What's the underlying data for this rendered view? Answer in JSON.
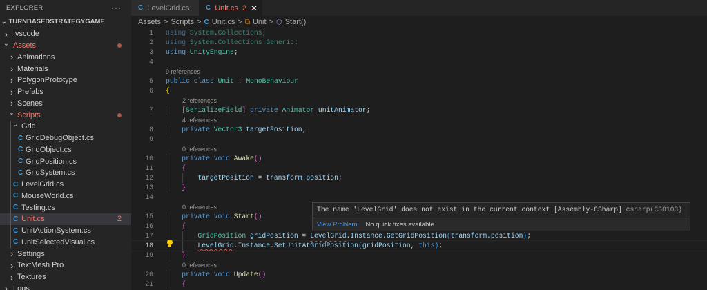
{
  "sidebar": {
    "title": "EXPLORER",
    "more": "···",
    "project": "TURNBASEDSTRATEGYGAME",
    "items": [
      {
        "label": ".vscode",
        "level": 0,
        "kind": "folder",
        "open": false
      },
      {
        "label": "Assets",
        "level": 0,
        "kind": "folder",
        "open": true,
        "error": true,
        "dot": true
      },
      {
        "label": "Animations",
        "level": 1,
        "kind": "folder",
        "open": false
      },
      {
        "label": "Materials",
        "level": 1,
        "kind": "folder",
        "open": false
      },
      {
        "label": "PolygonPrototype",
        "level": 1,
        "kind": "folder",
        "open": false
      },
      {
        "label": "Prefabs",
        "level": 1,
        "kind": "folder",
        "open": false
      },
      {
        "label": "Scenes",
        "level": 1,
        "kind": "folder",
        "open": false
      },
      {
        "label": "Scripts",
        "level": 1,
        "kind": "folder",
        "open": true,
        "error": true,
        "dot": true
      },
      {
        "label": "Grid",
        "level": 2,
        "kind": "folder",
        "open": true
      },
      {
        "label": "GridDebugObject.cs",
        "level": 3,
        "kind": "file"
      },
      {
        "label": "GridObject.cs",
        "level": 3,
        "kind": "file"
      },
      {
        "label": "GridPosition.cs",
        "level": 3,
        "kind": "file"
      },
      {
        "label": "GridSystem.cs",
        "level": 3,
        "kind": "file"
      },
      {
        "label": "LevelGrid.cs",
        "level": 2,
        "kind": "file"
      },
      {
        "label": "MouseWorld.cs",
        "level": 2,
        "kind": "file"
      },
      {
        "label": "Testing.cs",
        "level": 2,
        "kind": "file"
      },
      {
        "label": "Unit.cs",
        "level": 2,
        "kind": "file",
        "error": true,
        "selected": true,
        "badge": "2"
      },
      {
        "label": "UnitActionSystem.cs",
        "level": 2,
        "kind": "file"
      },
      {
        "label": "UnitSelectedVisual.cs",
        "level": 2,
        "kind": "file"
      },
      {
        "label": "Settings",
        "level": 1,
        "kind": "folder",
        "open": false
      },
      {
        "label": "TextMesh Pro",
        "level": 1,
        "kind": "folder",
        "open": false
      },
      {
        "label": "Textures",
        "level": 1,
        "kind": "folder",
        "open": false
      },
      {
        "label": "Logs",
        "level": 0,
        "kind": "folder",
        "open": false
      }
    ]
  },
  "tabs": [
    {
      "label": "LevelGrid.cs",
      "active": false
    },
    {
      "label": "Unit.cs",
      "active": true,
      "problems": "2",
      "close": "✕"
    }
  ],
  "breadcrumb": {
    "items": [
      "Assets",
      "Scripts",
      "Unit.cs",
      "Unit",
      "Start()"
    ],
    "sep": ">"
  },
  "editor": {
    "lines": [
      {
        "n": "1",
        "tk": [
          [
            "using ",
            "kw dim"
          ],
          [
            "System",
            "ty dim"
          ],
          [
            ".",
            "pl dim"
          ],
          [
            "Collections",
            "ty dim"
          ],
          [
            ";",
            "pl dim"
          ]
        ]
      },
      {
        "n": "2",
        "tk": [
          [
            "using ",
            "kw dim"
          ],
          [
            "System",
            "ty dim"
          ],
          [
            ".",
            "pl dim"
          ],
          [
            "Collections",
            "ty dim"
          ],
          [
            ".",
            "pl dim"
          ],
          [
            "Generic",
            "ty dim"
          ],
          [
            ";",
            "pl dim"
          ]
        ]
      },
      {
        "n": "3",
        "tk": [
          [
            "using ",
            "kw"
          ],
          [
            "UnityEngine",
            "ty"
          ],
          [
            ";",
            "pl"
          ]
        ]
      },
      {
        "n": "4",
        "tk": []
      },
      {
        "refs": "9 references",
        "indent": 0
      },
      {
        "n": "5",
        "tk": [
          [
            "public ",
            "kw"
          ],
          [
            "class ",
            "kw"
          ],
          [
            "Unit",
            "ty"
          ],
          [
            " : ",
            "pl"
          ],
          [
            "MonoBehaviour",
            "ty"
          ]
        ]
      },
      {
        "n": "6",
        "tk": [
          [
            "{",
            "br1"
          ]
        ]
      },
      {
        "refs": "2 references",
        "indent": 1
      },
      {
        "n": "7",
        "indent": 1,
        "tk": [
          [
            "[",
            "br2"
          ],
          [
            "SerializeField",
            "ty"
          ],
          [
            "]",
            "br2"
          ],
          [
            " private ",
            "kw"
          ],
          [
            "Animator ",
            "ty"
          ],
          [
            "unitAnimator",
            "id"
          ],
          [
            ";",
            "pl"
          ]
        ]
      },
      {
        "refs": "4 references",
        "indent": 1
      },
      {
        "n": "8",
        "indent": 1,
        "tk": [
          [
            "private ",
            "kw"
          ],
          [
            "Vector3 ",
            "ty"
          ],
          [
            "targetPosition",
            "id"
          ],
          [
            ";",
            "pl"
          ]
        ]
      },
      {
        "n": "9",
        "tk": []
      },
      {
        "refs": "0 references",
        "indent": 1
      },
      {
        "n": "10",
        "indent": 1,
        "tk": [
          [
            "private ",
            "kw"
          ],
          [
            "void ",
            "kw"
          ],
          [
            "Awake",
            "fn"
          ],
          [
            "()",
            "br2"
          ]
        ]
      },
      {
        "n": "11",
        "indent": 1,
        "tk": [
          [
            "{",
            "br2"
          ]
        ]
      },
      {
        "n": "12",
        "indent": 2,
        "tk": [
          [
            "targetPosition",
            "id"
          ],
          [
            " = ",
            "pl"
          ],
          [
            "transform",
            "id"
          ],
          [
            ".",
            "pl"
          ],
          [
            "position",
            "id"
          ],
          [
            ";",
            "pl"
          ]
        ]
      },
      {
        "n": "13",
        "indent": 1,
        "tk": [
          [
            "}",
            "br2"
          ]
        ]
      },
      {
        "n": "14",
        "tk": []
      },
      {
        "refs": "0 references",
        "indent": 1
      },
      {
        "n": "15",
        "indent": 1,
        "tk": [
          [
            "private ",
            "kw"
          ],
          [
            "void ",
            "kw"
          ],
          [
            "Start",
            "fn"
          ],
          [
            "()",
            "br2"
          ]
        ]
      },
      {
        "n": "16",
        "indent": 1,
        "tk": [
          [
            "{",
            "br2"
          ]
        ]
      },
      {
        "n": "17",
        "indent": 2,
        "tk": [
          [
            "GridPosition ",
            "ty"
          ],
          [
            "gridPosition",
            "id"
          ],
          [
            " = ",
            "pl"
          ],
          [
            "LevelGrid",
            "id err"
          ],
          [
            ".",
            "pl"
          ],
          [
            "Instance",
            "id"
          ],
          [
            ".",
            "pl"
          ],
          [
            "GetGridPosition",
            "id"
          ],
          [
            "(",
            "br3"
          ],
          [
            "transform",
            "id"
          ],
          [
            ".",
            "pl"
          ],
          [
            "position",
            "id"
          ],
          [
            ")",
            "br3"
          ],
          [
            ";",
            "pl"
          ]
        ]
      },
      {
        "n": "18",
        "indent": 2,
        "cur": true,
        "tk": [
          [
            "LevelGrid",
            "id err"
          ],
          [
            ".",
            "pl"
          ],
          [
            "Instance",
            "id"
          ],
          [
            ".",
            "pl"
          ],
          [
            "SetUnitAtGridPosition",
            "id"
          ],
          [
            "(",
            "br3"
          ],
          [
            "gridPosition",
            "id"
          ],
          [
            ", ",
            "pl"
          ],
          [
            "this",
            "kw"
          ],
          [
            ")",
            "br3"
          ],
          [
            ";",
            "pl"
          ]
        ]
      },
      {
        "n": "19",
        "indent": 1,
        "tk": [
          [
            "}",
            "br2"
          ]
        ]
      },
      {
        "refs": "0 references",
        "indent": 1
      },
      {
        "n": "20",
        "indent": 1,
        "tk": [
          [
            "private ",
            "kw"
          ],
          [
            "void ",
            "kw"
          ],
          [
            "Update",
            "fn"
          ],
          [
            "()",
            "br2"
          ]
        ]
      },
      {
        "n": "21",
        "indent": 1,
        "tk": [
          [
            "{",
            "br2"
          ]
        ]
      }
    ]
  },
  "hover": {
    "message": "The name 'LevelGrid' does not exist in the current context [Assembly-CSharp] ",
    "source": "csharp(CS0103)",
    "view_problem": "View Problem",
    "no_fixes": "No quick fixes available"
  },
  "colors": {
    "error": "#f0776a",
    "accent": "#3794ff",
    "editor_bg": "#1e1e1e",
    "sidebar_bg": "#252526"
  }
}
